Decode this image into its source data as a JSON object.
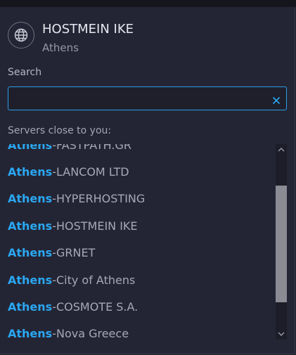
{
  "server": {
    "name": "HOSTMEIN IKE",
    "city": "Athens"
  },
  "search": {
    "label": "Search",
    "value": "",
    "placeholder": ""
  },
  "servers_close_label": "Servers close to you:",
  "servers": [
    {
      "city": "Athens",
      "provider": "FASTPATH.GR"
    },
    {
      "city": "Athens",
      "provider": "LANCOM LTD"
    },
    {
      "city": "Athens",
      "provider": "HYPERHOSTING"
    },
    {
      "city": "Athens",
      "provider": "HOSTMEIN IKE"
    },
    {
      "city": "Athens",
      "provider": "GRNET"
    },
    {
      "city": "Athens",
      "provider": "City of Athens"
    },
    {
      "city": "Athens",
      "provider": "COSMOTE S.A."
    },
    {
      "city": "Athens",
      "provider": "Nova Greece"
    }
  ],
  "separator": " - ",
  "colors": {
    "accent": "#2aa7f2",
    "panel_bg": "#242534",
    "text_primary": "#e6e7ef",
    "text_muted": "#a7a8b6"
  },
  "icons": {
    "server": "globe-icon",
    "clear": "close-icon",
    "scroll_up": "chevron-up-icon",
    "scroll_down": "chevron-down-icon"
  }
}
